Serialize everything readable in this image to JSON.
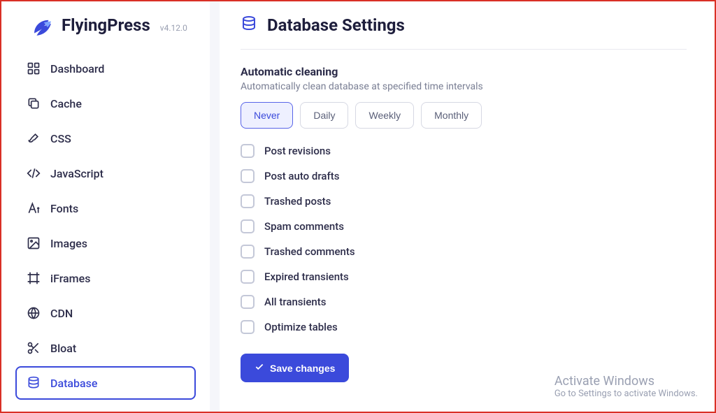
{
  "brand": {
    "name": "FlyingPress",
    "version": "v4.12.0"
  },
  "sidebar": {
    "items": [
      {
        "label": "Dashboard",
        "icon": "grid-icon",
        "active": false
      },
      {
        "label": "Cache",
        "icon": "copy-icon",
        "active": false
      },
      {
        "label": "CSS",
        "icon": "brush-icon",
        "active": false
      },
      {
        "label": "JavaScript",
        "icon": "code-icon",
        "active": false
      },
      {
        "label": "Fonts",
        "icon": "font-icon",
        "active": false
      },
      {
        "label": "Images",
        "icon": "image-icon",
        "active": false
      },
      {
        "label": "iFrames",
        "icon": "frame-icon",
        "active": false
      },
      {
        "label": "CDN",
        "icon": "globe-icon",
        "active": false
      },
      {
        "label": "Bloat",
        "icon": "scissors-icon",
        "active": false
      },
      {
        "label": "Database",
        "icon": "database-icon",
        "active": true
      }
    ]
  },
  "page": {
    "title": "Database Settings"
  },
  "section": {
    "title": "Automatic cleaning",
    "description": "Automatically clean database at specified time intervals"
  },
  "frequency": {
    "options": [
      {
        "label": "Never",
        "selected": true
      },
      {
        "label": "Daily",
        "selected": false
      },
      {
        "label": "Weekly",
        "selected": false
      },
      {
        "label": "Monthly",
        "selected": false
      }
    ]
  },
  "checks": [
    {
      "label": "Post revisions",
      "checked": false
    },
    {
      "label": "Post auto drafts",
      "checked": false
    },
    {
      "label": "Trashed posts",
      "checked": false
    },
    {
      "label": "Spam comments",
      "checked": false
    },
    {
      "label": "Trashed comments",
      "checked": false
    },
    {
      "label": "Expired transients",
      "checked": false
    },
    {
      "label": "All transients",
      "checked": false
    },
    {
      "label": "Optimize tables",
      "checked": false
    }
  ],
  "actions": {
    "save": "Save changes"
  },
  "watermark": {
    "title": "Activate Windows",
    "subtitle": "Go to Settings to activate Windows."
  }
}
